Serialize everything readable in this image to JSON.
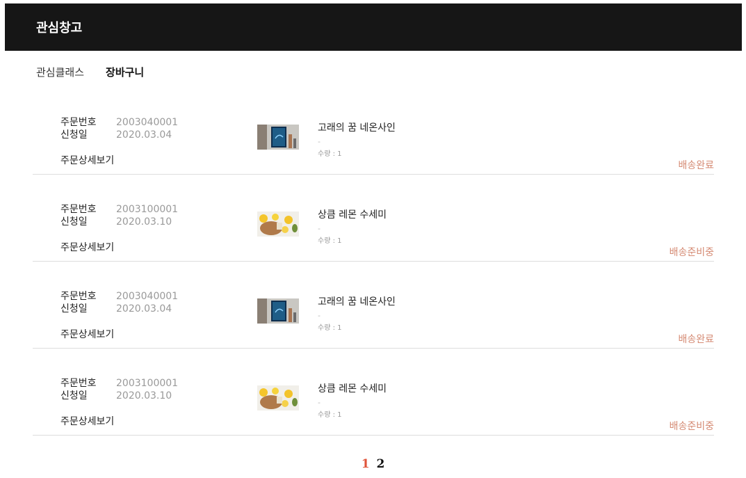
{
  "header": {
    "title": "관심창고"
  },
  "tabs": [
    {
      "label": "관심클래스",
      "active": false
    },
    {
      "label": "장바구니",
      "active": true
    }
  ],
  "labels": {
    "order_no": "주문번호",
    "applied_date": "신청일",
    "detail_link": "주문상세보기"
  },
  "orders": [
    {
      "order_no": "2003040001",
      "date": "2020.03.04",
      "product": "고래의 꿈 네온사인",
      "option": "-",
      "qty": "수량 : 1",
      "status": "배송완료",
      "image": "neon-whale-image"
    },
    {
      "order_no": "2003100001",
      "date": "2020.03.10",
      "product": "상큼 레몬 수세미",
      "option": "-",
      "qty": "수량 : 1",
      "status": "배송준비중",
      "image": "lemon-scrubber-image"
    },
    {
      "order_no": "2003040001",
      "date": "2020.03.04",
      "product": "고래의 꿈 네온사인",
      "option": "-",
      "qty": "수량 : 1",
      "status": "배송완료",
      "image": "neon-whale-image"
    },
    {
      "order_no": "2003100001",
      "date": "2020.03.10",
      "product": "상큼 레몬 수세미",
      "option": "-",
      "qty": "수량 : 1",
      "status": "배송준비중",
      "image": "lemon-scrubber-image"
    }
  ],
  "pagination": {
    "pages": [
      "1",
      "2"
    ],
    "current": "1"
  },
  "colors": {
    "header_bg": "#161616",
    "status": "#d58a73",
    "current_page": "#e0533a"
  }
}
